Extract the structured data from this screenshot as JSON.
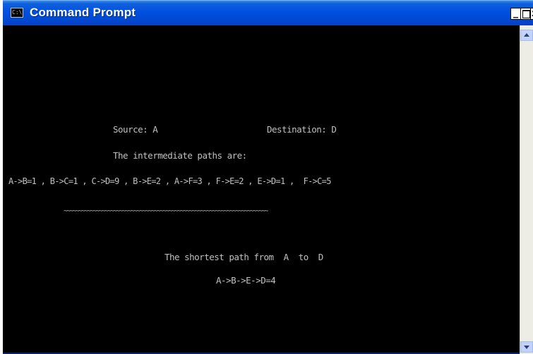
{
  "window": {
    "title": "Command Prompt",
    "icon_text": "C:\\",
    "controls": {
      "minimize": "_",
      "maximize": "",
      "close": "x"
    }
  },
  "console": {
    "source_line": "Source: A",
    "destination_line": "Destination: D",
    "intermediate_heading": "The intermediate paths are:",
    "paths_line": "A->B=1 , B->C=1 , C->D=9 , B->E=2 , A->F=3 , F->E=2 , E->D=1 ,  F->C=5",
    "separator": "~~~~~~~~~~~~~~~~~~~~~~~~~~~~~~~~~~~~~~~~~~~~~~~~~~~~~~~~~~~~~~~~~~~~~~",
    "shortest_heading": "The shortest path from  A  to  D",
    "shortest_result": "A->B->E->D=4"
  },
  "colors": {
    "console_bg": "#000000",
    "console_text": "#c0c0c0",
    "titlebar": "#0050e0"
  },
  "icons": [
    "console-app-icon",
    "minimize-icon",
    "maximize-icon",
    "close-icon",
    "scroll-up-icon",
    "scroll-down-icon"
  ]
}
